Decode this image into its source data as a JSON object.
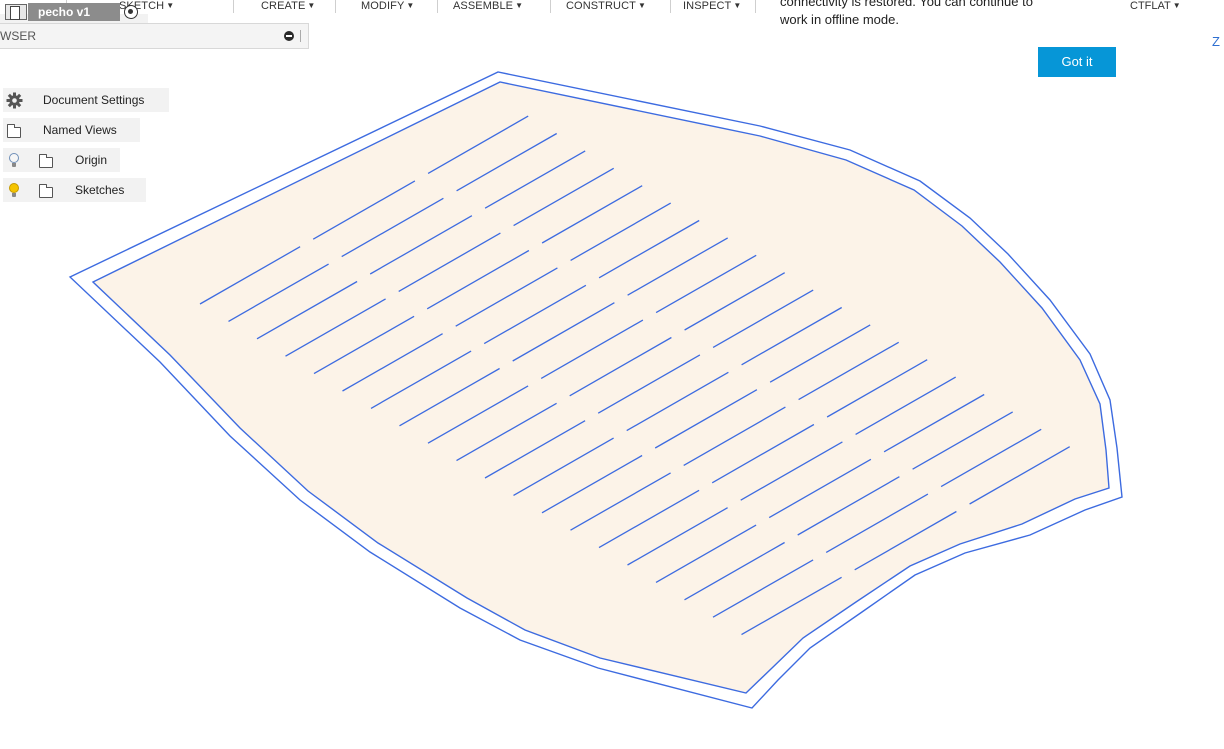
{
  "toolbar": {
    "items": [
      {
        "label": "SKETCH"
      },
      {
        "label": "CREATE"
      },
      {
        "label": "MODIFY"
      },
      {
        "label": "ASSEMBLE"
      },
      {
        "label": "CONSTRUCT"
      },
      {
        "label": "INSPECT"
      }
    ],
    "truncated_item": "CTFLAT",
    "caret_glyph": "▼"
  },
  "browser": {
    "title": "WSER",
    "root": {
      "label": "pecho v1"
    },
    "items": [
      {
        "label": "Document Settings",
        "icon": "gear-icon"
      },
      {
        "label": "Named Views",
        "icon": "folder-icon"
      },
      {
        "label": "Origin",
        "icon": "folder-icon",
        "visibility": "hidden-bulb"
      },
      {
        "label": "Sketches",
        "icon": "folder-icon",
        "visibility": "lit-bulb"
      }
    ]
  },
  "notification": {
    "text_line1": "connectivity is restored. You can continue to",
    "text_line2": "work in offline mode.",
    "button_label": "Got it"
  },
  "viewport": {
    "axis_label": "Z",
    "sketch_fill": "#fcf3e8",
    "line_color": "#3d6be0"
  },
  "colors": {
    "accent": "#0696d7",
    "sketch_line": "#3d6be0",
    "panel_bg": "#f2f2f2"
  }
}
